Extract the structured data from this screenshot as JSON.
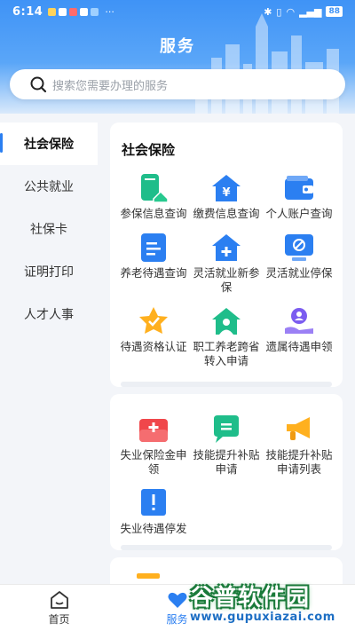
{
  "status_bar": {
    "time": "6:14",
    "extra": "···",
    "battery": "88"
  },
  "page": {
    "title": "服务"
  },
  "search": {
    "placeholder": "搜索您需要办理的服务"
  },
  "sidebar": {
    "items": [
      {
        "label": "社会保险",
        "active": true
      },
      {
        "label": "公共就业",
        "active": false
      },
      {
        "label": "社保卡",
        "active": false
      },
      {
        "label": "证明打印",
        "active": false
      },
      {
        "label": "人才人事",
        "active": false
      }
    ]
  },
  "section": {
    "title": "社会保险",
    "group1": [
      {
        "label": "参保信息查询",
        "icon": "phone-home-icon"
      },
      {
        "label": "缴费信息查询",
        "icon": "yuan-house-icon"
      },
      {
        "label": "个人账户查询",
        "icon": "wallet-icon"
      },
      {
        "label": "养老待遇查询",
        "icon": "document-list-icon"
      },
      {
        "label": "灵活就业新参保",
        "icon": "house-plus-icon"
      },
      {
        "label": "灵活就业停保",
        "icon": "stop-screen-icon"
      },
      {
        "label": "待遇资格认证",
        "icon": "star-badge-icon"
      },
      {
        "label": "职工养老跨省转入申请",
        "icon": "person-house-icon"
      },
      {
        "label": "遗属待遇申领",
        "icon": "hand-person-icon"
      }
    ],
    "group2": [
      {
        "label": "失业保险金申领",
        "icon": "briefcase-plus-icon"
      },
      {
        "label": "技能提升补贴申请",
        "icon": "chat-bubble-icon"
      },
      {
        "label": "技能提升补贴申请列表",
        "icon": "megaphone-icon"
      },
      {
        "label": "失业待遇停发",
        "icon": "notice-alert-icon"
      }
    ]
  },
  "bottom_nav": {
    "items": [
      {
        "label": "首页",
        "active": false
      },
      {
        "label": "服务",
        "active": true
      }
    ]
  },
  "watermark": {
    "main": "谷普软件园",
    "sub": "www.gupuxiazai.com"
  },
  "colors": {
    "accent": "#2b7ff1",
    "teal": "#1fbd8a",
    "purple": "#7b5cf0",
    "red": "#f0474b",
    "orange": "#ffb01f"
  }
}
